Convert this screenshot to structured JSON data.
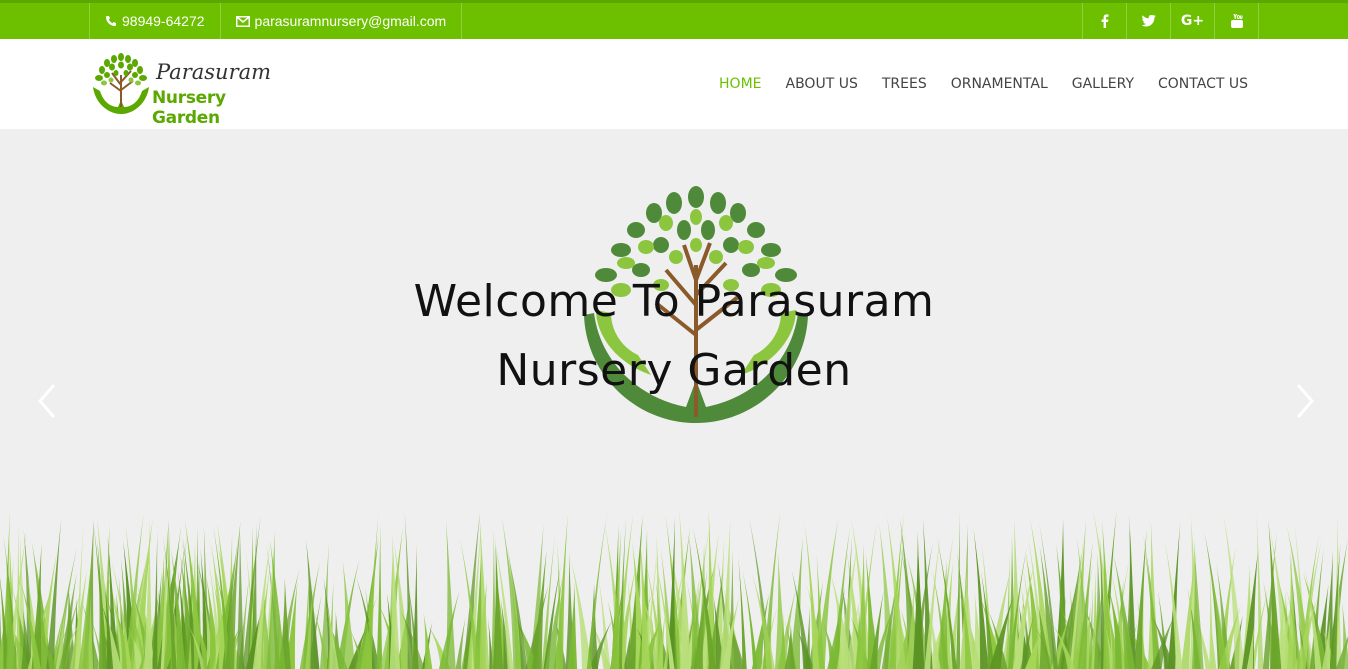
{
  "topbar": {
    "phone": "98949-64272",
    "email": "parasuramnursery@gmail.com",
    "social": [
      {
        "name": "facebook",
        "glyph": "f"
      },
      {
        "name": "twitter",
        "glyph": "t"
      },
      {
        "name": "google-plus",
        "glyph": "G+"
      },
      {
        "name": "youtube",
        "glyph": "yt"
      }
    ]
  },
  "logo": {
    "line1": "Parasuram",
    "line2": "Nursery Garden"
  },
  "nav": [
    {
      "label": "HOME",
      "active": true
    },
    {
      "label": "ABOUT US"
    },
    {
      "label": "TREES"
    },
    {
      "label": "ORNAMENTAL"
    },
    {
      "label": "GALLERY"
    },
    {
      "label": "CONTACT US"
    }
  ],
  "hero": {
    "title_line1": "Welcome To Parasuram",
    "title_line2": "Nursery Garden"
  },
  "colors": {
    "accent": "#6cc000",
    "nav_text": "#444444",
    "hero_bg": "#efefef"
  }
}
